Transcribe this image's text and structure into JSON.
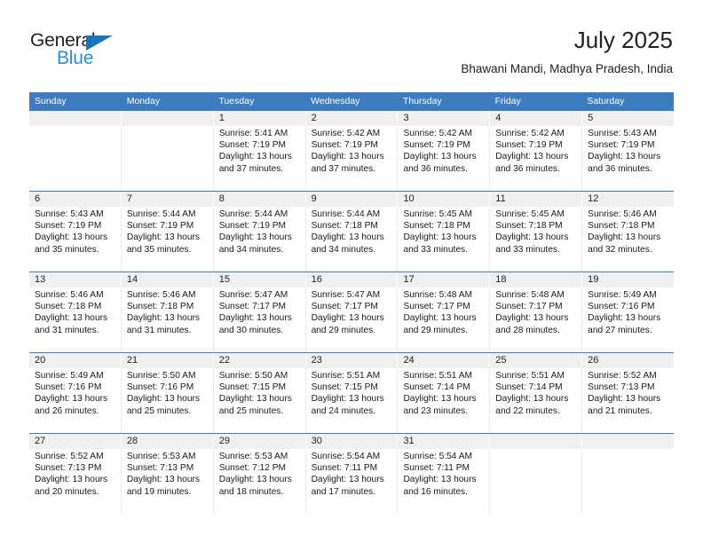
{
  "brand": {
    "name_top": "General",
    "name_bottom": "Blue",
    "accent_color": "#1b75bc",
    "accent_light": "#2a8fd4"
  },
  "header": {
    "title": "July 2025",
    "subtitle": "Bhawani Mandi, Madhya Pradesh, India"
  },
  "theme": {
    "header_blue": "#3c7cbf",
    "daynum_band": "#f0f0f0",
    "text": "#1a1a1a"
  },
  "weekdays": [
    "Sunday",
    "Monday",
    "Tuesday",
    "Wednesday",
    "Thursday",
    "Friday",
    "Saturday"
  ],
  "weeks": [
    [
      {
        "day": "",
        "sunrise": "",
        "sunset": "",
        "daylight_1": "",
        "daylight_2": ""
      },
      {
        "day": "",
        "sunrise": "",
        "sunset": "",
        "daylight_1": "",
        "daylight_2": ""
      },
      {
        "day": "1",
        "sunrise": "Sunrise: 5:41 AM",
        "sunset": "Sunset: 7:19 PM",
        "daylight_1": "Daylight: 13 hours",
        "daylight_2": "and 37 minutes."
      },
      {
        "day": "2",
        "sunrise": "Sunrise: 5:42 AM",
        "sunset": "Sunset: 7:19 PM",
        "daylight_1": "Daylight: 13 hours",
        "daylight_2": "and 37 minutes."
      },
      {
        "day": "3",
        "sunrise": "Sunrise: 5:42 AM",
        "sunset": "Sunset: 7:19 PM",
        "daylight_1": "Daylight: 13 hours",
        "daylight_2": "and 36 minutes."
      },
      {
        "day": "4",
        "sunrise": "Sunrise: 5:42 AM",
        "sunset": "Sunset: 7:19 PM",
        "daylight_1": "Daylight: 13 hours",
        "daylight_2": "and 36 minutes."
      },
      {
        "day": "5",
        "sunrise": "Sunrise: 5:43 AM",
        "sunset": "Sunset: 7:19 PM",
        "daylight_1": "Daylight: 13 hours",
        "daylight_2": "and 36 minutes."
      }
    ],
    [
      {
        "day": "6",
        "sunrise": "Sunrise: 5:43 AM",
        "sunset": "Sunset: 7:19 PM",
        "daylight_1": "Daylight: 13 hours",
        "daylight_2": "and 35 minutes."
      },
      {
        "day": "7",
        "sunrise": "Sunrise: 5:44 AM",
        "sunset": "Sunset: 7:19 PM",
        "daylight_1": "Daylight: 13 hours",
        "daylight_2": "and 35 minutes."
      },
      {
        "day": "8",
        "sunrise": "Sunrise: 5:44 AM",
        "sunset": "Sunset: 7:19 PM",
        "daylight_1": "Daylight: 13 hours",
        "daylight_2": "and 34 minutes."
      },
      {
        "day": "9",
        "sunrise": "Sunrise: 5:44 AM",
        "sunset": "Sunset: 7:18 PM",
        "daylight_1": "Daylight: 13 hours",
        "daylight_2": "and 34 minutes."
      },
      {
        "day": "10",
        "sunrise": "Sunrise: 5:45 AM",
        "sunset": "Sunset: 7:18 PM",
        "daylight_1": "Daylight: 13 hours",
        "daylight_2": "and 33 minutes."
      },
      {
        "day": "11",
        "sunrise": "Sunrise: 5:45 AM",
        "sunset": "Sunset: 7:18 PM",
        "daylight_1": "Daylight: 13 hours",
        "daylight_2": "and 33 minutes."
      },
      {
        "day": "12",
        "sunrise": "Sunrise: 5:46 AM",
        "sunset": "Sunset: 7:18 PM",
        "daylight_1": "Daylight: 13 hours",
        "daylight_2": "and 32 minutes."
      }
    ],
    [
      {
        "day": "13",
        "sunrise": "Sunrise: 5:46 AM",
        "sunset": "Sunset: 7:18 PM",
        "daylight_1": "Daylight: 13 hours",
        "daylight_2": "and 31 minutes."
      },
      {
        "day": "14",
        "sunrise": "Sunrise: 5:46 AM",
        "sunset": "Sunset: 7:18 PM",
        "daylight_1": "Daylight: 13 hours",
        "daylight_2": "and 31 minutes."
      },
      {
        "day": "15",
        "sunrise": "Sunrise: 5:47 AM",
        "sunset": "Sunset: 7:17 PM",
        "daylight_1": "Daylight: 13 hours",
        "daylight_2": "and 30 minutes."
      },
      {
        "day": "16",
        "sunrise": "Sunrise: 5:47 AM",
        "sunset": "Sunset: 7:17 PM",
        "daylight_1": "Daylight: 13 hours",
        "daylight_2": "and 29 minutes."
      },
      {
        "day": "17",
        "sunrise": "Sunrise: 5:48 AM",
        "sunset": "Sunset: 7:17 PM",
        "daylight_1": "Daylight: 13 hours",
        "daylight_2": "and 29 minutes."
      },
      {
        "day": "18",
        "sunrise": "Sunrise: 5:48 AM",
        "sunset": "Sunset: 7:17 PM",
        "daylight_1": "Daylight: 13 hours",
        "daylight_2": "and 28 minutes."
      },
      {
        "day": "19",
        "sunrise": "Sunrise: 5:49 AM",
        "sunset": "Sunset: 7:16 PM",
        "daylight_1": "Daylight: 13 hours",
        "daylight_2": "and 27 minutes."
      }
    ],
    [
      {
        "day": "20",
        "sunrise": "Sunrise: 5:49 AM",
        "sunset": "Sunset: 7:16 PM",
        "daylight_1": "Daylight: 13 hours",
        "daylight_2": "and 26 minutes."
      },
      {
        "day": "21",
        "sunrise": "Sunrise: 5:50 AM",
        "sunset": "Sunset: 7:16 PM",
        "daylight_1": "Daylight: 13 hours",
        "daylight_2": "and 25 minutes."
      },
      {
        "day": "22",
        "sunrise": "Sunrise: 5:50 AM",
        "sunset": "Sunset: 7:15 PM",
        "daylight_1": "Daylight: 13 hours",
        "daylight_2": "and 25 minutes."
      },
      {
        "day": "23",
        "sunrise": "Sunrise: 5:51 AM",
        "sunset": "Sunset: 7:15 PM",
        "daylight_1": "Daylight: 13 hours",
        "daylight_2": "and 24 minutes."
      },
      {
        "day": "24",
        "sunrise": "Sunrise: 5:51 AM",
        "sunset": "Sunset: 7:14 PM",
        "daylight_1": "Daylight: 13 hours",
        "daylight_2": "and 23 minutes."
      },
      {
        "day": "25",
        "sunrise": "Sunrise: 5:51 AM",
        "sunset": "Sunset: 7:14 PM",
        "daylight_1": "Daylight: 13 hours",
        "daylight_2": "and 22 minutes."
      },
      {
        "day": "26",
        "sunrise": "Sunrise: 5:52 AM",
        "sunset": "Sunset: 7:13 PM",
        "daylight_1": "Daylight: 13 hours",
        "daylight_2": "and 21 minutes."
      }
    ],
    [
      {
        "day": "27",
        "sunrise": "Sunrise: 5:52 AM",
        "sunset": "Sunset: 7:13 PM",
        "daylight_1": "Daylight: 13 hours",
        "daylight_2": "and 20 minutes."
      },
      {
        "day": "28",
        "sunrise": "Sunrise: 5:53 AM",
        "sunset": "Sunset: 7:13 PM",
        "daylight_1": "Daylight: 13 hours",
        "daylight_2": "and 19 minutes."
      },
      {
        "day": "29",
        "sunrise": "Sunrise: 5:53 AM",
        "sunset": "Sunset: 7:12 PM",
        "daylight_1": "Daylight: 13 hours",
        "daylight_2": "and 18 minutes."
      },
      {
        "day": "30",
        "sunrise": "Sunrise: 5:54 AM",
        "sunset": "Sunset: 7:11 PM",
        "daylight_1": "Daylight: 13 hours",
        "daylight_2": "and 17 minutes."
      },
      {
        "day": "31",
        "sunrise": "Sunrise: 5:54 AM",
        "sunset": "Sunset: 7:11 PM",
        "daylight_1": "Daylight: 13 hours",
        "daylight_2": "and 16 minutes."
      },
      {
        "day": "",
        "sunrise": "",
        "sunset": "",
        "daylight_1": "",
        "daylight_2": ""
      },
      {
        "day": "",
        "sunrise": "",
        "sunset": "",
        "daylight_1": "",
        "daylight_2": ""
      }
    ]
  ]
}
